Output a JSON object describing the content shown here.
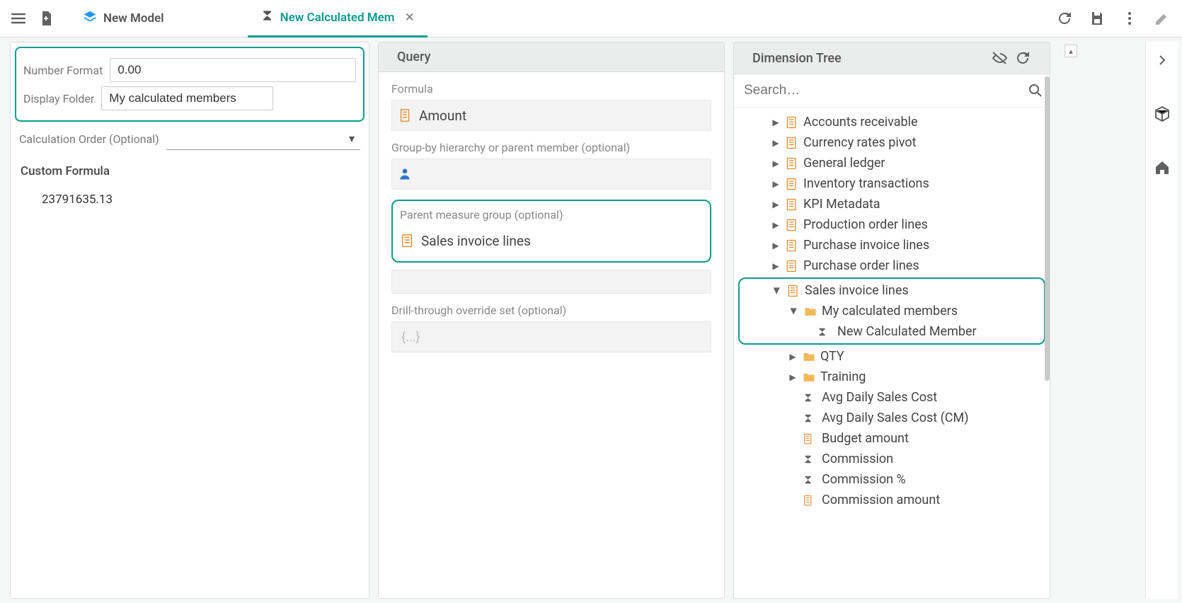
{
  "topbar": {
    "model_tab": "New Model",
    "calc_tab": "New Calculated Mem",
    "close": "✕"
  },
  "left": {
    "number_format_label": "Number Format",
    "number_format_value": "0.00",
    "display_folder_label": "Display Folder",
    "display_folder_value": "My calculated members",
    "calc_order_label": "Calculation Order (Optional)",
    "custom_formula_label": "Custom Formula",
    "custom_formula_value": "23791635.13"
  },
  "query": {
    "title": "Query",
    "formula_label": "Formula",
    "formula_value": "Amount",
    "groupby_label": "Group-by hierarchy or parent member (optional)",
    "parent_mg_label": "Parent measure group (optional)",
    "parent_mg_value": "Sales invoice lines",
    "drill_label": "Drill-through override set (optional)",
    "drill_placeholder": "{...}"
  },
  "tree": {
    "title": "Dimension Tree",
    "search_placeholder": "Search…",
    "items": {
      "ar": "Accounts receivable",
      "cur": "Currency rates pivot",
      "gl": "General ledger",
      "inv": "Inventory transactions",
      "kpi": "KPI Metadata",
      "prod": "Production order lines",
      "pil": "Purchase invoice lines",
      "pol": "Purchase order lines",
      "sil": "Sales invoice lines",
      "mycalc": "My calculated members",
      "newcalc": "New Calculated Member",
      "qty": "QTY",
      "training": "Training",
      "avg1": "Avg Daily Sales Cost",
      "avg2": "Avg Daily Sales Cost (CM)",
      "budget": "Budget amount",
      "comm": "Commission",
      "commpct": "Commission %",
      "commamt": "Commission amount"
    }
  }
}
